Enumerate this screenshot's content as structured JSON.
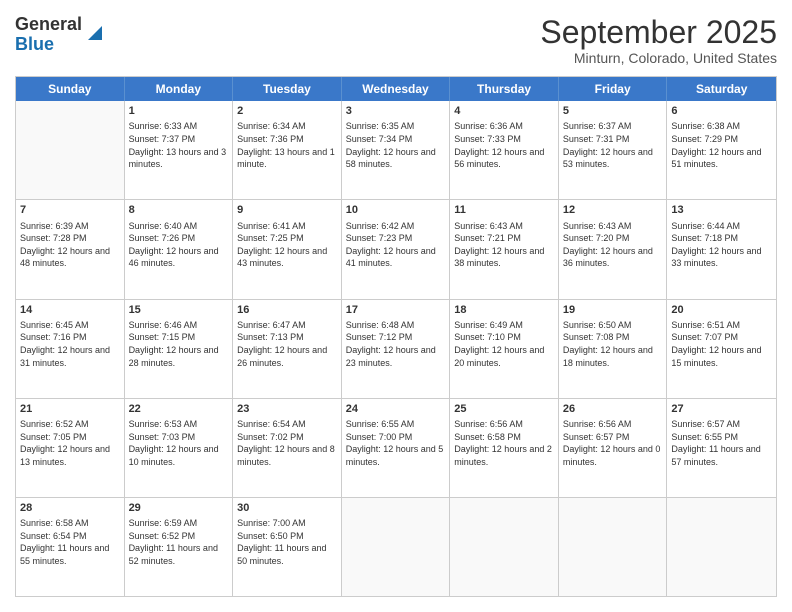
{
  "header": {
    "logo_general": "General",
    "logo_blue": "Blue",
    "title": "September 2025",
    "subtitle": "Minturn, Colorado, United States"
  },
  "calendar": {
    "days": [
      "Sunday",
      "Monday",
      "Tuesday",
      "Wednesday",
      "Thursday",
      "Friday",
      "Saturday"
    ],
    "rows": [
      [
        {
          "day": "",
          "empty": true
        },
        {
          "day": "1",
          "sunrise": "Sunrise: 6:33 AM",
          "sunset": "Sunset: 7:37 PM",
          "daylight": "Daylight: 13 hours and 3 minutes."
        },
        {
          "day": "2",
          "sunrise": "Sunrise: 6:34 AM",
          "sunset": "Sunset: 7:36 PM",
          "daylight": "Daylight: 13 hours and 1 minute."
        },
        {
          "day": "3",
          "sunrise": "Sunrise: 6:35 AM",
          "sunset": "Sunset: 7:34 PM",
          "daylight": "Daylight: 12 hours and 58 minutes."
        },
        {
          "day": "4",
          "sunrise": "Sunrise: 6:36 AM",
          "sunset": "Sunset: 7:33 PM",
          "daylight": "Daylight: 12 hours and 56 minutes."
        },
        {
          "day": "5",
          "sunrise": "Sunrise: 6:37 AM",
          "sunset": "Sunset: 7:31 PM",
          "daylight": "Daylight: 12 hours and 53 minutes."
        },
        {
          "day": "6",
          "sunrise": "Sunrise: 6:38 AM",
          "sunset": "Sunset: 7:29 PM",
          "daylight": "Daylight: 12 hours and 51 minutes."
        }
      ],
      [
        {
          "day": "7",
          "sunrise": "Sunrise: 6:39 AM",
          "sunset": "Sunset: 7:28 PM",
          "daylight": "Daylight: 12 hours and 48 minutes."
        },
        {
          "day": "8",
          "sunrise": "Sunrise: 6:40 AM",
          "sunset": "Sunset: 7:26 PM",
          "daylight": "Daylight: 12 hours and 46 minutes."
        },
        {
          "day": "9",
          "sunrise": "Sunrise: 6:41 AM",
          "sunset": "Sunset: 7:25 PM",
          "daylight": "Daylight: 12 hours and 43 minutes."
        },
        {
          "day": "10",
          "sunrise": "Sunrise: 6:42 AM",
          "sunset": "Sunset: 7:23 PM",
          "daylight": "Daylight: 12 hours and 41 minutes."
        },
        {
          "day": "11",
          "sunrise": "Sunrise: 6:43 AM",
          "sunset": "Sunset: 7:21 PM",
          "daylight": "Daylight: 12 hours and 38 minutes."
        },
        {
          "day": "12",
          "sunrise": "Sunrise: 6:43 AM",
          "sunset": "Sunset: 7:20 PM",
          "daylight": "Daylight: 12 hours and 36 minutes."
        },
        {
          "day": "13",
          "sunrise": "Sunrise: 6:44 AM",
          "sunset": "Sunset: 7:18 PM",
          "daylight": "Daylight: 12 hours and 33 minutes."
        }
      ],
      [
        {
          "day": "14",
          "sunrise": "Sunrise: 6:45 AM",
          "sunset": "Sunset: 7:16 PM",
          "daylight": "Daylight: 12 hours and 31 minutes."
        },
        {
          "day": "15",
          "sunrise": "Sunrise: 6:46 AM",
          "sunset": "Sunset: 7:15 PM",
          "daylight": "Daylight: 12 hours and 28 minutes."
        },
        {
          "day": "16",
          "sunrise": "Sunrise: 6:47 AM",
          "sunset": "Sunset: 7:13 PM",
          "daylight": "Daylight: 12 hours and 26 minutes."
        },
        {
          "day": "17",
          "sunrise": "Sunrise: 6:48 AM",
          "sunset": "Sunset: 7:12 PM",
          "daylight": "Daylight: 12 hours and 23 minutes."
        },
        {
          "day": "18",
          "sunrise": "Sunrise: 6:49 AM",
          "sunset": "Sunset: 7:10 PM",
          "daylight": "Daylight: 12 hours and 20 minutes."
        },
        {
          "day": "19",
          "sunrise": "Sunrise: 6:50 AM",
          "sunset": "Sunset: 7:08 PM",
          "daylight": "Daylight: 12 hours and 18 minutes."
        },
        {
          "day": "20",
          "sunrise": "Sunrise: 6:51 AM",
          "sunset": "Sunset: 7:07 PM",
          "daylight": "Daylight: 12 hours and 15 minutes."
        }
      ],
      [
        {
          "day": "21",
          "sunrise": "Sunrise: 6:52 AM",
          "sunset": "Sunset: 7:05 PM",
          "daylight": "Daylight: 12 hours and 13 minutes."
        },
        {
          "day": "22",
          "sunrise": "Sunrise: 6:53 AM",
          "sunset": "Sunset: 7:03 PM",
          "daylight": "Daylight: 12 hours and 10 minutes."
        },
        {
          "day": "23",
          "sunrise": "Sunrise: 6:54 AM",
          "sunset": "Sunset: 7:02 PM",
          "daylight": "Daylight: 12 hours and 8 minutes."
        },
        {
          "day": "24",
          "sunrise": "Sunrise: 6:55 AM",
          "sunset": "Sunset: 7:00 PM",
          "daylight": "Daylight: 12 hours and 5 minutes."
        },
        {
          "day": "25",
          "sunrise": "Sunrise: 6:56 AM",
          "sunset": "Sunset: 6:58 PM",
          "daylight": "Daylight: 12 hours and 2 minutes."
        },
        {
          "day": "26",
          "sunrise": "Sunrise: 6:56 AM",
          "sunset": "Sunset: 6:57 PM",
          "daylight": "Daylight: 12 hours and 0 minutes."
        },
        {
          "day": "27",
          "sunrise": "Sunrise: 6:57 AM",
          "sunset": "Sunset: 6:55 PM",
          "daylight": "Daylight: 11 hours and 57 minutes."
        }
      ],
      [
        {
          "day": "28",
          "sunrise": "Sunrise: 6:58 AM",
          "sunset": "Sunset: 6:54 PM",
          "daylight": "Daylight: 11 hours and 55 minutes."
        },
        {
          "day": "29",
          "sunrise": "Sunrise: 6:59 AM",
          "sunset": "Sunset: 6:52 PM",
          "daylight": "Daylight: 11 hours and 52 minutes."
        },
        {
          "day": "30",
          "sunrise": "Sunrise: 7:00 AM",
          "sunset": "Sunset: 6:50 PM",
          "daylight": "Daylight: 11 hours and 50 minutes."
        },
        {
          "day": "",
          "empty": true
        },
        {
          "day": "",
          "empty": true
        },
        {
          "day": "",
          "empty": true
        },
        {
          "day": "",
          "empty": true
        }
      ]
    ]
  }
}
